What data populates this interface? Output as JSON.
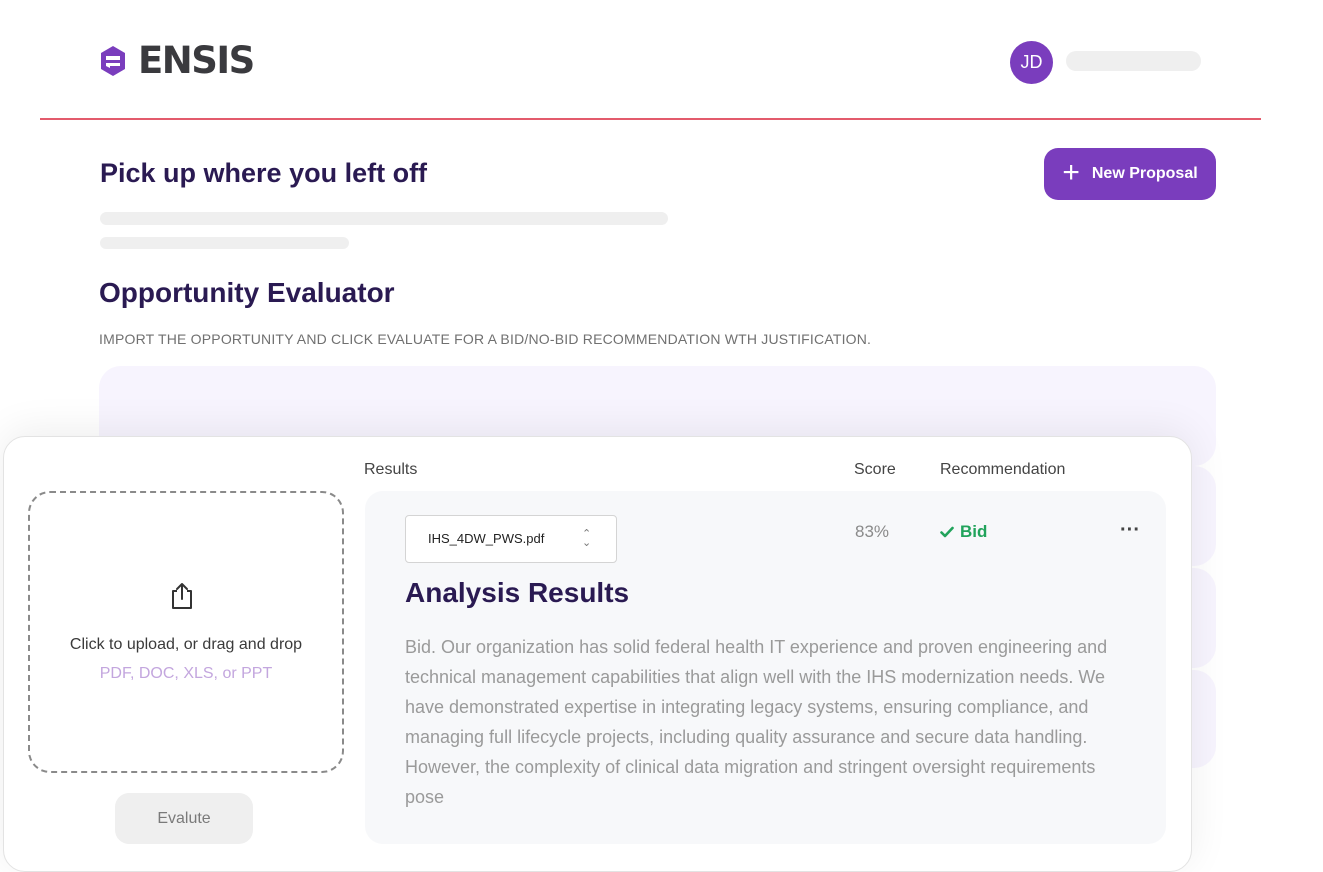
{
  "header": {
    "brand": "ENSIS",
    "user_initials": "JD",
    "colors": {
      "accent": "#7a3dbd",
      "rule": "#e35b6c",
      "heading": "#2a1a52"
    }
  },
  "resume": {
    "title": "Pick up where you left off",
    "new_button_label": "New Proposal",
    "new_button_icon": "plus-icon"
  },
  "evaluator": {
    "title": "Opportunity Evaluator",
    "subtitle": "IMPORT THE OPPORTUNITY AND CLICK EVALUATE FOR A BID/NO-BID RECOMMENDATION WTH JUSTIFICATION.",
    "upload": {
      "icon": "upload-icon",
      "prompt": "Click to upload, or drag and drop",
      "types": "PDF, DOC, XLS, or PPT",
      "evaluate_label": "Evalute"
    },
    "columns": {
      "results": "Results",
      "score": "Score",
      "recommendation": "Recommendation"
    },
    "result": {
      "file": "IHS_4DW_PWS.pdf",
      "score": "83%",
      "recommendation": "Bid",
      "recommendation_icon": "check-icon",
      "recommendation_color": "#21a35b",
      "more_label": "···",
      "analysis_title": "Analysis Results",
      "analysis_text": "Bid. Our organization has solid federal health IT experience and proven engineering and technical management capabilities that align well with the IHS modernization needs. We have demonstrated expertise in integrating legacy systems, ensuring compliance, and managing full lifecycle projects, including quality assurance and secure data handling. However, the complexity of clinical data migration and stringent oversight requirements pose"
    }
  }
}
